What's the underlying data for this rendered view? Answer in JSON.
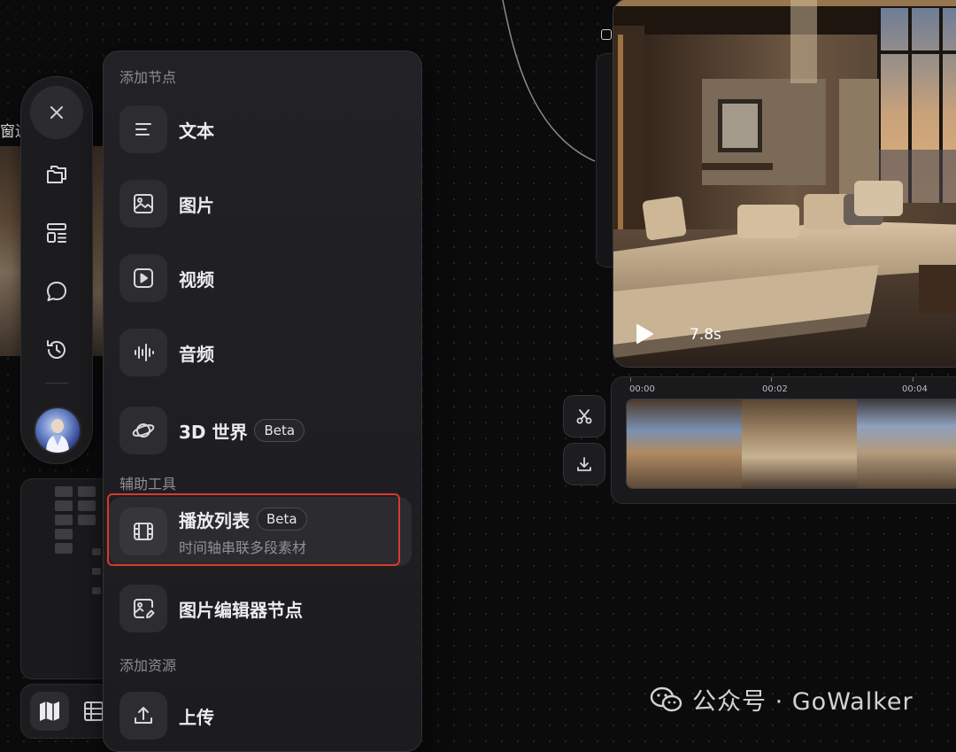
{
  "menu": {
    "sections": [
      {
        "title": "添加节点"
      },
      {
        "title": "辅助工具"
      },
      {
        "title": "添加资源"
      }
    ],
    "items": [
      {
        "label": "文本",
        "icon": "text-icon"
      },
      {
        "label": "图片",
        "icon": "image-icon"
      },
      {
        "label": "视频",
        "icon": "video-icon"
      },
      {
        "label": "音频",
        "icon": "audio-icon"
      },
      {
        "label": "3D 世界",
        "icon": "planet-icon",
        "badge": "Beta"
      },
      {
        "label": "播放列表",
        "icon": "film-icon",
        "badge": "Beta",
        "subtitle": "时间轴串联多段素材",
        "highlighted": true
      },
      {
        "label": "图片编辑器节点",
        "icon": "image-edit-icon"
      },
      {
        "label": "上传",
        "icon": "upload-icon"
      }
    ]
  },
  "left": {
    "cut_text": "窗边"
  },
  "video": {
    "duration": "7.8s"
  },
  "timeline": {
    "ticks": [
      "00:00",
      "00:02",
      "00:04"
    ]
  },
  "watermark": {
    "text": "公众号 · GoWalker"
  },
  "colors": {
    "highlight_frame": "#d9392b",
    "background": "#0b0b0c",
    "menu_bg": "#1e1e21"
  }
}
